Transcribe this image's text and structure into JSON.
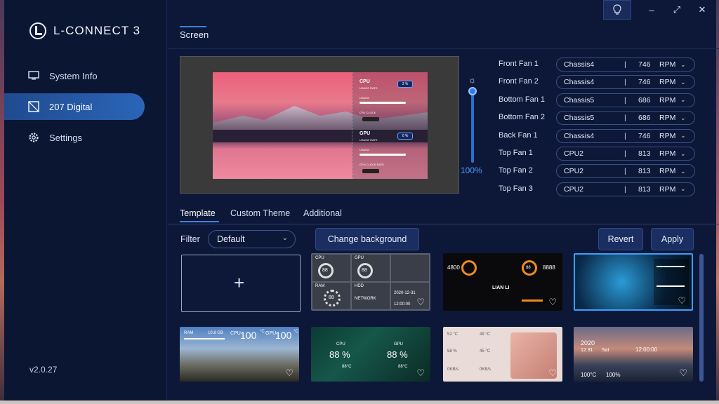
{
  "app": {
    "name": "L-CONNECT 3",
    "version": "v2.0.27"
  },
  "sidebar": {
    "items": [
      {
        "label": "System Info",
        "icon": "monitor-icon"
      },
      {
        "label": "207 Digital",
        "icon": "display-icon",
        "active": true
      },
      {
        "label": "Settings",
        "icon": "gear-icon"
      }
    ]
  },
  "header": {
    "tab": "Screen"
  },
  "window": {
    "bulb": "💡",
    "minimize": "–",
    "maximize": "⤢",
    "close": "✕"
  },
  "preview": {
    "cpu_title": "CPU",
    "cpu_sub": "USAGE RATE",
    "cpu_val": "3 %",
    "cpu_usage": "USAGE",
    "cpu_clock": "CPU CLOCK",
    "gpu_title": "GPU",
    "gpu_sub": "USAGE RATE",
    "gpu_val": "0 %",
    "gpu_usage": "USAGE",
    "gpu_clock": "GPU CLOCK RATE"
  },
  "brightness": {
    "value": "100%",
    "icon": "sun-icon"
  },
  "fans": [
    {
      "label": "Front Fan 1",
      "source": "Chassis4",
      "rpm": "746",
      "unit": "RPM"
    },
    {
      "label": "Front Fan 2",
      "source": "Chassis4",
      "rpm": "746",
      "unit": "RPM"
    },
    {
      "label": "Bottom Fan 1",
      "source": "Chassis5",
      "rpm": "686",
      "unit": "RPM"
    },
    {
      "label": "Bottom Fan 2",
      "source": "Chassis5",
      "rpm": "686",
      "unit": "RPM"
    },
    {
      "label": "Back Fan 1",
      "source": "Chassis4",
      "rpm": "746",
      "unit": "RPM"
    },
    {
      "label": "Top Fan 1",
      "source": "CPU2",
      "rpm": "813",
      "unit": "RPM"
    },
    {
      "label": "Top Fan 2",
      "source": "CPU2",
      "rpm": "813",
      "unit": "RPM"
    },
    {
      "label": "Top Fan 3",
      "source": "CPU2",
      "rpm": "813",
      "unit": "RPM"
    }
  ],
  "tabs": [
    "Template",
    "Custom Theme",
    "Additional"
  ],
  "filter": {
    "label": "Filter",
    "value": "Default"
  },
  "buttons": {
    "change_bg": "Change background",
    "revert": "Revert",
    "apply": "Apply"
  },
  "templates": {
    "t1": {
      "cpu": "CPU",
      "gpu": "GPU",
      "ram": "RAM",
      "hdd": "HDD",
      "network": "NETWORK",
      "date": "2020-12-31",
      "time": "12:00:00",
      "g88": "88"
    },
    "t2": {
      "speed": "4800",
      "brand": "LIAN LI",
      "gpu": "8888",
      "pct": "88"
    },
    "t4": {
      "ram": "RAM",
      "ram_val": "10.8 GB",
      "cpu": "CPU",
      "cpu_temp": "100",
      "gpu": "GPU",
      "gpu_temp": "100",
      "unit": "°C"
    },
    "t5": {
      "cpu": "CPU",
      "gpu": "GPU",
      "cpu_pct": "88 %",
      "gpu_pct": "88 %",
      "cpu_temp": "88°C",
      "gpu_temp": "88°C"
    },
    "t6": {
      "cpu_temp": "52 °C",
      "gpu_temp": "49 °C",
      "ram": "58 %",
      "ssd": "45 °C",
      "up": "0KB/s",
      "down": "0KB/s"
    },
    "t7": {
      "year": "2020",
      "date": "12.31",
      "day": "Sat",
      "time": "12:00:00",
      "cpu_temp": "100°C",
      "gpu_usage": "100%"
    }
  },
  "colors": {
    "accent": "#2f7de6",
    "bg": "#0d1838"
  }
}
